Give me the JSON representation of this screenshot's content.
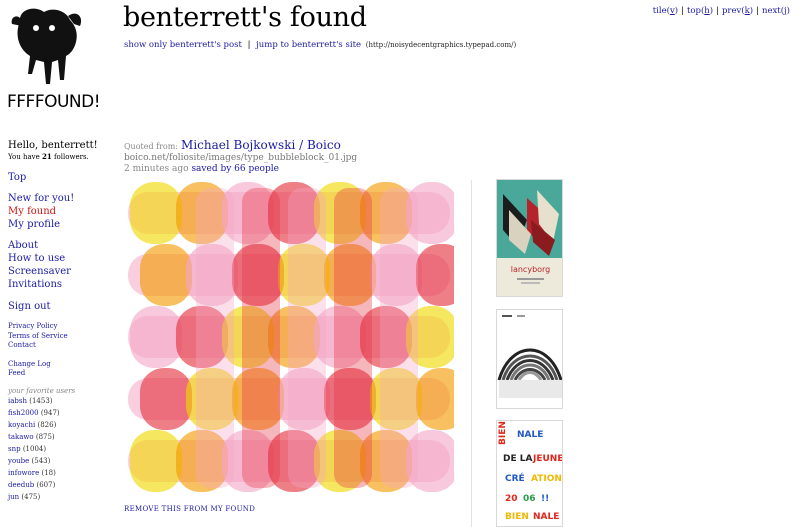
{
  "logo": {
    "text": "FFFFOUND!"
  },
  "header": {
    "title": "benterrett's found",
    "show_only_label": "show only benterrett's post",
    "separator": "|",
    "jump_label": "jump to benterrett's site",
    "site_url": "(http://noisydecentgraphics.typepad.com/)"
  },
  "pager": [
    {
      "label": "tile",
      "key": "v"
    },
    {
      "label": "top",
      "key": "h"
    },
    {
      "label": "prev",
      "key": "k"
    },
    {
      "label": "next",
      "key": "j"
    }
  ],
  "sidebar": {
    "greeting": "Hello, benterrett!",
    "followers_prefix": "You have",
    "followers_count": "21",
    "followers_suffix": "followers.",
    "top_label": "Top",
    "new_for_you_label": "New for you!",
    "my_found_label": "My found",
    "my_profile_label": "My profile",
    "about_label": "About",
    "how_to_use_label": "How to use",
    "screensaver_label": "Screensaver",
    "invitations_label": "Invitations",
    "sign_out_label": "Sign out",
    "privacy_label": "Privacy Policy",
    "terms_label": "Terms of Service",
    "contact_label": "Contact",
    "changelog_label": "Change Log",
    "feed_label": "Feed",
    "favorites_title": "your favorite users",
    "favorites": [
      {
        "name": "iabsh",
        "count": "(1453)"
      },
      {
        "name": "fish2000",
        "count": "(947)"
      },
      {
        "name": "koyachi",
        "count": "(826)"
      },
      {
        "name": "takawo",
        "count": "(875)"
      },
      {
        "name": "snp",
        "count": "(1004)"
      },
      {
        "name": "yoube",
        "count": "(543)"
      },
      {
        "name": "infowore",
        "count": "(18)"
      },
      {
        "name": "deedub",
        "count": "(607)"
      },
      {
        "name": "jun",
        "count": "(475)"
      }
    ]
  },
  "post": {
    "quoted_from_label": "Quoted from:",
    "quoted_from_link": "Michael Bojkowski / Boico",
    "source_url": "boico.net/foliosite/images/type_bubbleblock_01.jpg",
    "time_ago": "2 minutes ago",
    "saved_by": "saved by 66 people",
    "remove_label": "REMOVE THIS FROM MY FOUND"
  },
  "thumbnails": [
    {
      "caption": "lancyborg"
    },
    {
      "caption": ""
    },
    {
      "caption": "BIENNALE DE LA JEUNE CRÉATION 2006"
    }
  ],
  "colors": {
    "link": "#1a1aa6",
    "active_nav": "#cc1111",
    "bubble_yellow": "#f0d800",
    "bubble_orange": "#f39a00",
    "bubble_pink": "#f4a7c6",
    "bubble_red": "#e4313e"
  }
}
